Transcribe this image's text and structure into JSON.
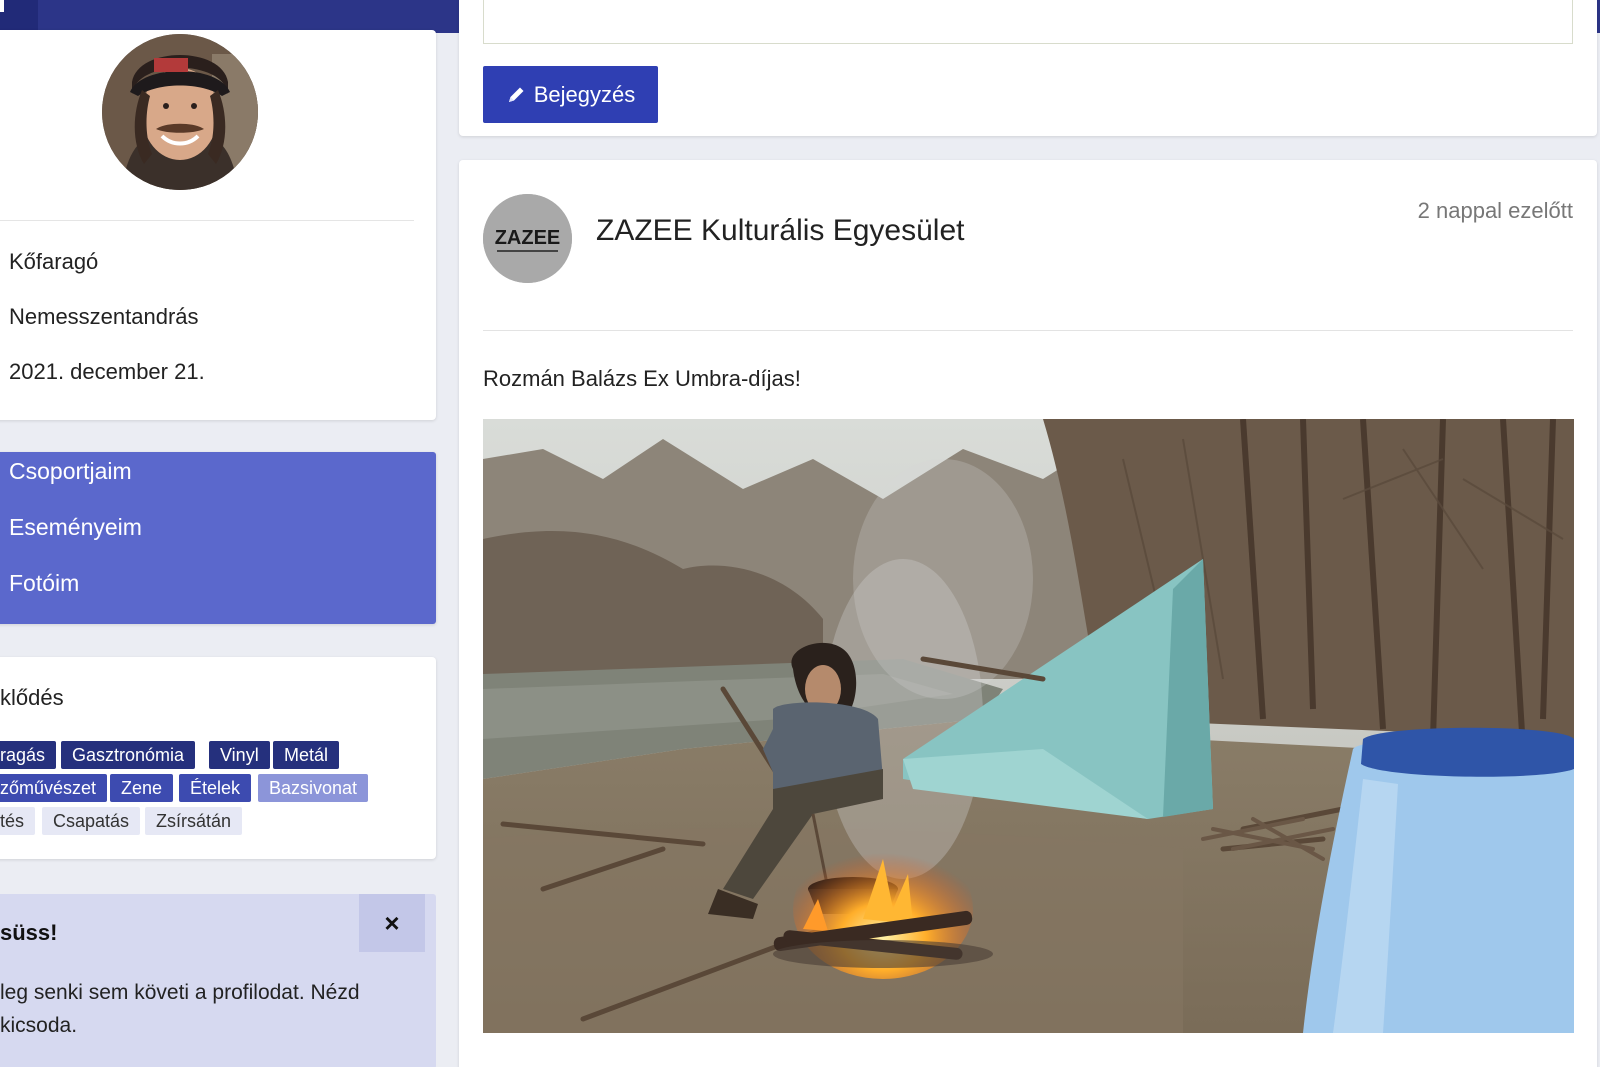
{
  "profile": {
    "occupation": "Kőfaragó",
    "location": "Nemesszentandrás",
    "date": "2021. december 21."
  },
  "menu": {
    "items": [
      {
        "label": "Csoportjaim"
      },
      {
        "label": "Eseményeim"
      },
      {
        "label": "Fotóim"
      }
    ]
  },
  "interests": {
    "title": "klődés",
    "tags": [
      {
        "label": "ragás"
      },
      {
        "label": "Gasztronómia"
      },
      {
        "label": "Vinyl"
      },
      {
        "label": "Metál"
      },
      {
        "label": "zőművészet"
      },
      {
        "label": "Zene"
      },
      {
        "label": "Ételek"
      },
      {
        "label": "Bazsivonat"
      },
      {
        "label": "tés"
      },
      {
        "label": "Csapatás"
      },
      {
        "label": "Zsírsátán"
      }
    ]
  },
  "alert": {
    "title": "süss!",
    "body_line1": "leg senki sem követi a profilodat. Nézd",
    "body_line2": " kicsoda.",
    "close_symbol": "×"
  },
  "compose": {
    "button_label": "Bejegyzés"
  },
  "post": {
    "author": "ZAZEE Kulturális Egyesület",
    "time": "2 nappal ezelőtt",
    "text": "Rozmán Balázs Ex Umbra-díjas!"
  },
  "colors": {
    "topbar": "#2c3588",
    "menu": "#5b68cc",
    "button": "#2f3fb3",
    "tag_dark": "#25307d"
  }
}
